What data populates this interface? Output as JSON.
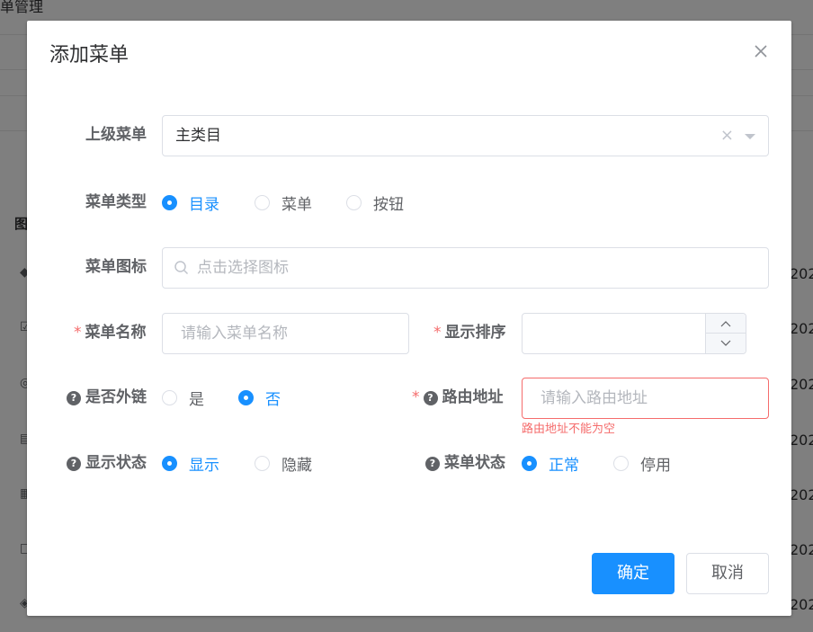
{
  "background": {
    "page_title": "单管理",
    "table_head": "图",
    "row_icons": [
      "◆",
      "☑",
      "◎",
      "▤",
      "▦",
      "□",
      "◈"
    ],
    "year_fragment": "202"
  },
  "dialog": {
    "title": "添加菜单",
    "parent_menu": {
      "label": "上级菜单",
      "value": "主类目"
    },
    "menu_type": {
      "label": "菜单类型",
      "options": [
        "目录",
        "菜单",
        "按钮"
      ],
      "selected": "目录"
    },
    "menu_icon": {
      "label": "菜单图标",
      "placeholder": "点击选择图标"
    },
    "menu_name": {
      "required": "*",
      "label": "菜单名称",
      "placeholder": "请输入菜单名称"
    },
    "display_order": {
      "required": "*",
      "label": "显示排序",
      "value": ""
    },
    "is_external": {
      "label": "是否外链",
      "options": [
        "是",
        "否"
      ],
      "selected": "否"
    },
    "route_path": {
      "required": "*",
      "label": "路由地址",
      "placeholder": "请输入路由地址",
      "error": "路由地址不能为空"
    },
    "visible_status": {
      "label": "显示状态",
      "options": [
        "显示",
        "隐藏"
      ],
      "selected": "显示"
    },
    "menu_status": {
      "label": "菜单状态",
      "options": [
        "正常",
        "停用"
      ],
      "selected": "正常"
    },
    "confirm_label": "确定",
    "cancel_label": "取消",
    "help_icon_glyph": "?"
  },
  "colors": {
    "primary": "#1890ff",
    "error": "#f56c6c"
  }
}
